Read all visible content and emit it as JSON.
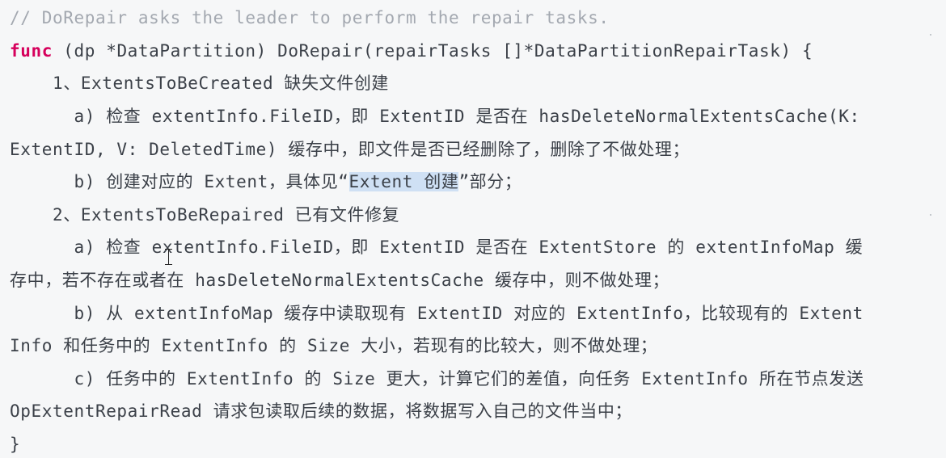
{
  "code": {
    "comment": "// DoRepair asks the leader to perform the repair tasks.",
    "func_keyword": "func",
    "signature": " (dp *DataPartition) DoRepair(repairTasks []*DataPartitionRepairTask) {",
    "l3": "    1、ExtentsToBeCreated 缺失文件创建",
    "l4": "      a) 检查 extentInfo.FileID，即 ExtentID 是否在 hasDeleteNormalExtentsCache(K:",
    "l5": "ExtentID, V: DeletedTime) 缓存中，即文件是否已经删除了，删除了不做处理；",
    "l6_before": "      b) 创建对应的 Extent，具体见“",
    "l6_highlight": "Extent 创建",
    "l6_after": "”部分；",
    "l7": "    2、ExtentsToBeRepaired 已有文件修复",
    "l8": "      a) 检查 extentInfo.FileID，即 ExtentID 是否在 ExtentStore 的 extentInfoMap 缓",
    "l9": "存中，若不存在或者在 hasDeleteNormalExtentsCache 缓存中，则不做处理；",
    "l10": "      b) 从 extentInfoMap 缓存中读取现有 ExtentID 对应的 ExtentInfo，比较现有的 Extent",
    "l11": "Info 和任务中的 ExtentInfo 的 Size 大小，若现有的比较大，则不做处理；",
    "l12": "      c) 任务中的 ExtentInfo 的 Size 更大，计算它们的差值，向任务 ExtentInfo 所在节点发送",
    "l13": "OpExtentRepairRead 请求包读取后续的数据，将数据写入自己的文件当中；",
    "closing": "}"
  },
  "colors": {
    "background": "#f6f7f8",
    "text": "#3b4048",
    "comment": "#a3a8b0",
    "keyword": "#d6005c",
    "selection": "#cfe0f4"
  }
}
